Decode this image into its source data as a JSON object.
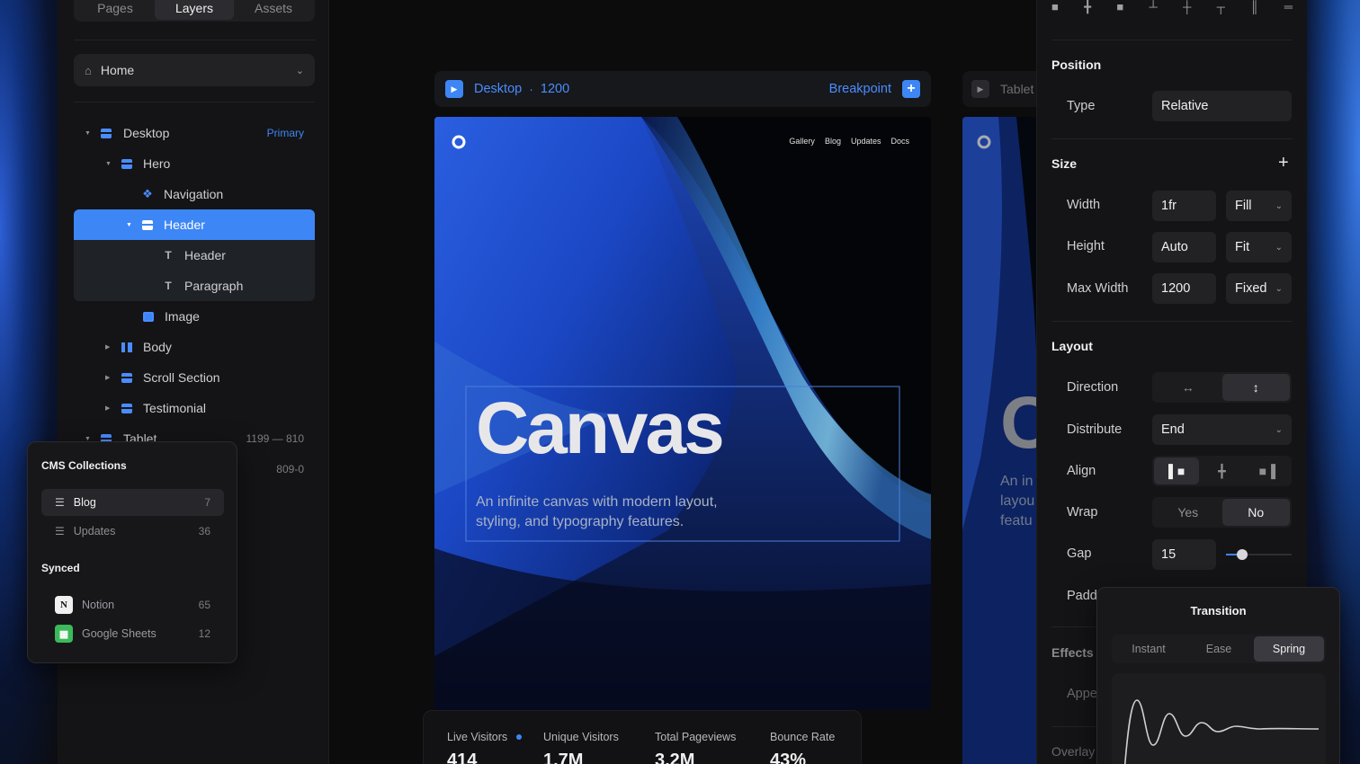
{
  "left_panel": {
    "tabs": [
      "Pages",
      "Layers",
      "Assets"
    ],
    "active_tab": "Layers",
    "page_select": "Home",
    "layers": [
      {
        "label": "Desktop",
        "meta": "Primary"
      },
      {
        "label": "Hero"
      },
      {
        "label": "Navigation"
      },
      {
        "label": "Header"
      },
      {
        "label": "Header"
      },
      {
        "label": "Paragraph"
      },
      {
        "label": "Image"
      },
      {
        "label": "Body"
      },
      {
        "label": "Scroll Section"
      },
      {
        "label": "Testimonial"
      },
      {
        "label": "Tablet",
        "meta": "1199 — 810"
      },
      {
        "label": "",
        "meta": "809-0"
      }
    ]
  },
  "cms": {
    "title": "CMS Collections",
    "collections": [
      {
        "label": "Blog",
        "count": "7"
      },
      {
        "label": "Updates",
        "count": "36"
      }
    ],
    "synced_title": "Synced",
    "synced": [
      {
        "label": "Notion",
        "count": "65"
      },
      {
        "label": "Google Sheets",
        "count": "12"
      }
    ]
  },
  "canvas": {
    "breakpoint_name": "Desktop",
    "breakpoint_sep": "·",
    "breakpoint_width": "1200",
    "breakpoint_button": "Breakpoint",
    "tablet_label": "Tablet",
    "nav": [
      "Gallery",
      "Blog",
      "Updates",
      "Docs"
    ],
    "hero_title": "Canvas",
    "hero_text_1": "An infinite canvas with modern layout,",
    "hero_text_2": "styling, and typography features.",
    "tablet_title": "C",
    "tablet_text": [
      "An in",
      "layou",
      "featu"
    ],
    "stats": [
      {
        "label": "Live Visitors",
        "value": "414"
      },
      {
        "label": "Unique Visitors",
        "value": "1.7M"
      },
      {
        "label": "Total Pageviews",
        "value": "3.2M"
      },
      {
        "label": "Bounce Rate",
        "value": "43%"
      }
    ]
  },
  "right_panel": {
    "position": {
      "title": "Position",
      "type_label": "Type",
      "type_value": "Relative"
    },
    "size": {
      "title": "Size",
      "add": "+",
      "width_label": "Width",
      "width_value": "1fr",
      "width_mode": "Fill",
      "height_label": "Height",
      "height_value": "Auto",
      "height_mode": "Fit",
      "maxw_label": "Max Width",
      "maxw_value": "1200",
      "maxw_mode": "Fixed"
    },
    "layout": {
      "title": "Layout",
      "direction_label": "Direction",
      "direction_value": "vertical",
      "distribute_label": "Distribute",
      "distribute_value": "End",
      "align_label": "Align",
      "align_value": "start",
      "wrap_label": "Wrap",
      "wrap_options": [
        "Yes",
        "No"
      ],
      "wrap_value": "No",
      "gap_label": "Gap",
      "gap_value": "15",
      "gap_slider_fraction": 0.25,
      "padding_label": "Padd"
    },
    "effects": {
      "title": "Effects",
      "appear_label": "Appe",
      "overlay_label": "Overlay"
    }
  },
  "transition": {
    "title": "Transition",
    "options": [
      "Instant",
      "Ease",
      "Spring"
    ],
    "selected": "Spring"
  },
  "colors": {
    "accent": "#3d86f5",
    "panel": "#141416",
    "field": "#222225"
  }
}
